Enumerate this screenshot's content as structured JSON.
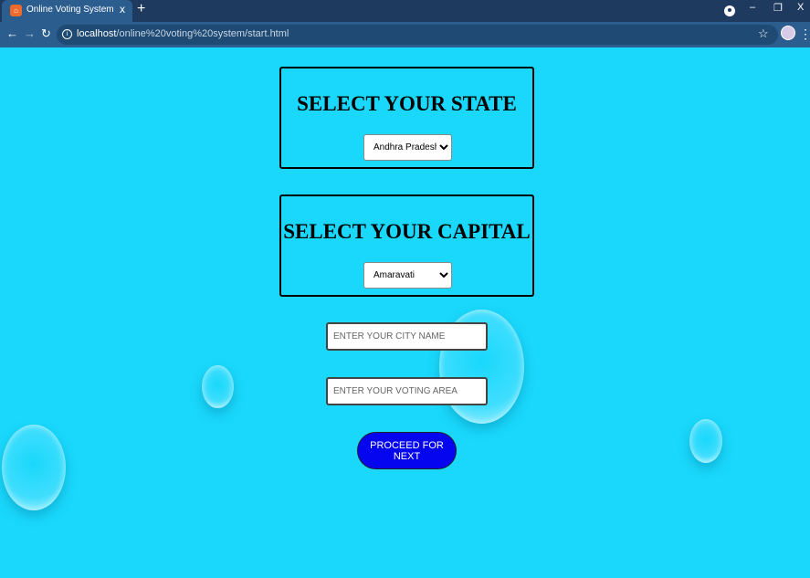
{
  "browser": {
    "tab_title": "Online Voting System",
    "tab_close": "x",
    "new_tab": "+",
    "url_host": "localhost",
    "url_path": "/online%20voting%20system/start.html",
    "window_min": "–",
    "window_max": "❐",
    "window_close": "X"
  },
  "state_section": {
    "heading": "SELECT YOUR STATE",
    "selected": "Andhra Pradesh"
  },
  "capital_section": {
    "heading": "SELECT YOUR CAPITAL",
    "selected": "Amaravati"
  },
  "city_input": {
    "placeholder": "ENTER YOUR CITY NAME",
    "value": ""
  },
  "area_input": {
    "placeholder": "ENTER YOUR VOTING AREA",
    "value": ""
  },
  "proceed_button": {
    "label": "PROCEED FOR NEXT"
  },
  "colors": {
    "page_background": "#19d8fb",
    "button_background": "#0505f0",
    "browser_frame": "#1f3a5f"
  },
  "icons": [
    "favicon-icon",
    "close-icon",
    "plus-icon",
    "back-arrow-icon",
    "forward-arrow-icon",
    "reload-icon",
    "info-icon",
    "star-icon",
    "profile-icon",
    "menu-icon",
    "minimize-icon",
    "maximize-icon",
    "window-close-icon"
  ]
}
